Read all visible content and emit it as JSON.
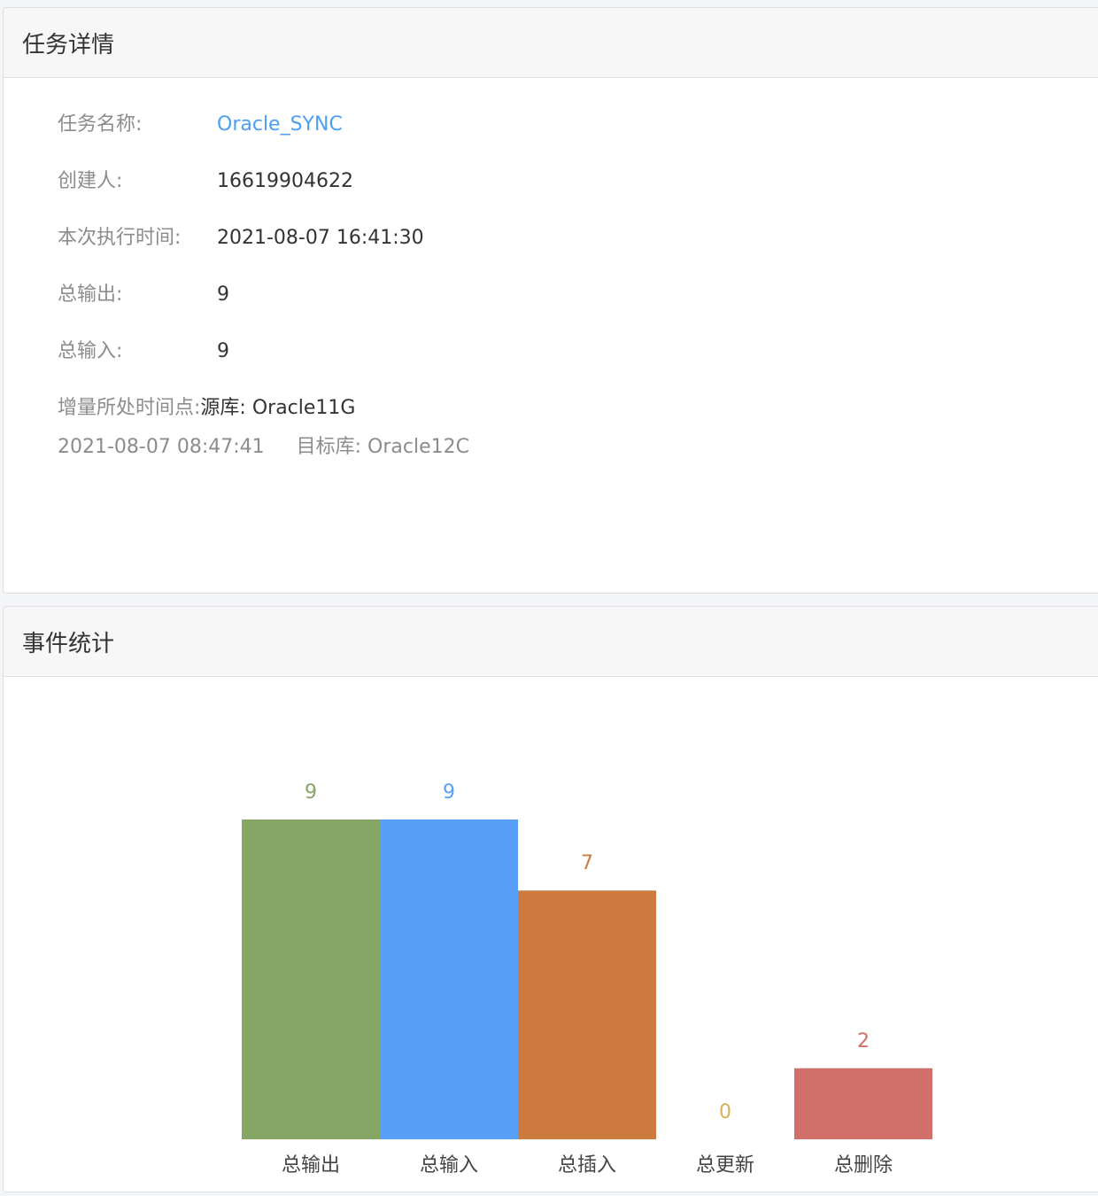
{
  "task_panel": {
    "title": "任务详情",
    "fields": {
      "name_label": "任务名称:",
      "name_value": "Oracle_SYNC",
      "creator_label": "创建人:",
      "creator_value": "16619904622",
      "exec_time_label": "本次执行时间:",
      "exec_time_value": "2021-08-07 16:41:30",
      "total_output_label": "总输出:",
      "total_output_value": "9",
      "total_input_label": "总输入:",
      "total_input_value": "9",
      "incremental_label": "增量所处时间点:",
      "source_db": "源库: Oracle11G",
      "incremental_time": "2021-08-07 08:47:41",
      "target_db": "目标库: Oracle12C"
    }
  },
  "event_panel": {
    "title": "事件统计"
  },
  "chart_data": {
    "type": "bar",
    "categories": [
      "总输出",
      "总输入",
      "总插入",
      "总更新",
      "总删除"
    ],
    "values": [
      9,
      9,
      7,
      0,
      2
    ],
    "colors": [
      "#85a664",
      "#589ff8",
      "#cd7a3e",
      "#d8b153",
      "#d1706b"
    ],
    "ylim": [
      0,
      9
    ]
  }
}
